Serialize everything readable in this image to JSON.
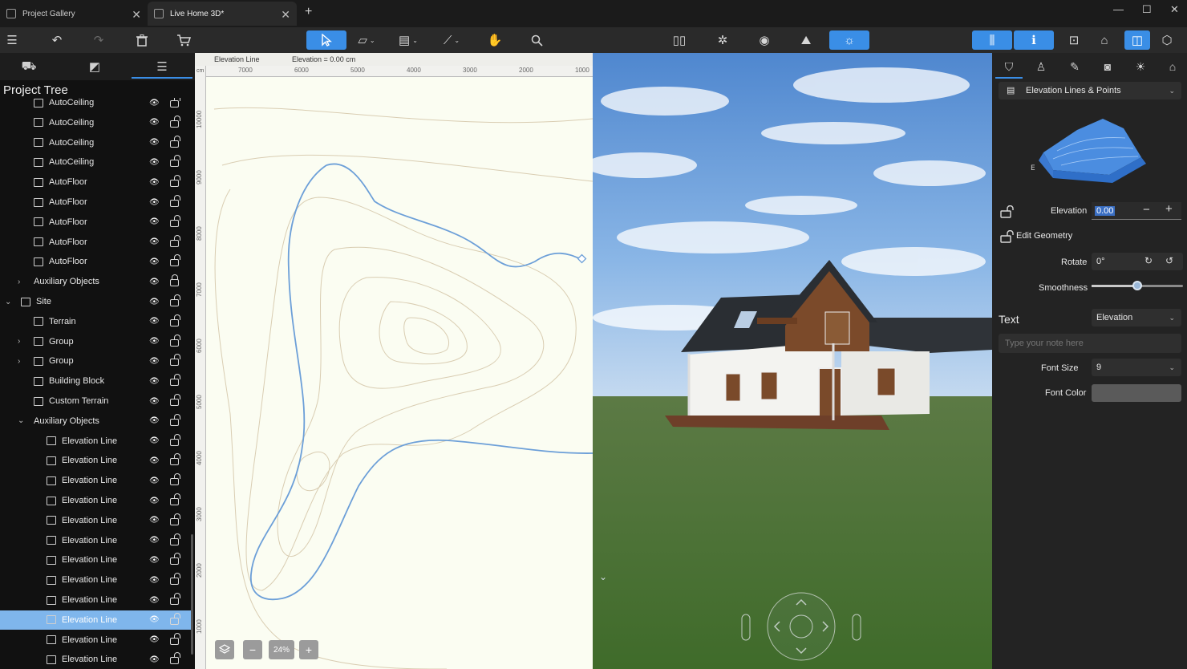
{
  "tabs": [
    {
      "label": "Project Gallery",
      "active": false
    },
    {
      "label": "Live Home 3D*",
      "active": true
    }
  ],
  "toolbar": {
    "left_icons": [
      "menu-icon",
      "undo-icon",
      "redo-icon",
      "trash-icon",
      "cart-icon"
    ],
    "center_icons": [
      "select-arrow-icon",
      "wall-tool-icon",
      "floor-tool-icon",
      "dimension-tool-icon",
      "pan-hand-icon",
      "search-icon"
    ],
    "view_icons": [
      "cameras-icon",
      "walkthrough-icon",
      "eye-icon",
      "roof-icon",
      "sun-icon"
    ],
    "right_icons": [
      "library-icon",
      "inspector-icon",
      "plan-view-icon",
      "3d-house-icon",
      "split-view-icon",
      "3d-box-icon"
    ]
  },
  "left_panel": {
    "tab_icons": [
      "furniture-icon",
      "materials-icon",
      "project-tree-icon"
    ],
    "title": "Project Tree",
    "rows": [
      {
        "label": "AutoCeiling",
        "indent": 2,
        "icon": "ceiling-icon",
        "chev": "",
        "locked": false,
        "selected": false
      },
      {
        "label": "AutoCeiling",
        "indent": 2,
        "icon": "ceiling-icon",
        "chev": "",
        "locked": false,
        "selected": false
      },
      {
        "label": "AutoCeiling",
        "indent": 2,
        "icon": "ceiling-icon",
        "chev": "",
        "locked": false,
        "selected": false
      },
      {
        "label": "AutoCeiling",
        "indent": 2,
        "icon": "ceiling-icon",
        "chev": "",
        "locked": false,
        "selected": false
      },
      {
        "label": "AutoFloor",
        "indent": 2,
        "icon": "floor-icon",
        "chev": "",
        "locked": false,
        "selected": false
      },
      {
        "label": "AutoFloor",
        "indent": 2,
        "icon": "floor-icon",
        "chev": "",
        "locked": false,
        "selected": false
      },
      {
        "label": "AutoFloor",
        "indent": 2,
        "icon": "floor-icon",
        "chev": "",
        "locked": false,
        "selected": false
      },
      {
        "label": "AutoFloor",
        "indent": 2,
        "icon": "floor-icon",
        "chev": "",
        "locked": false,
        "selected": false
      },
      {
        "label": "AutoFloor",
        "indent": 2,
        "icon": "floor-icon",
        "chev": "",
        "locked": false,
        "selected": false
      },
      {
        "label": "Auxiliary Objects",
        "indent": 1,
        "icon": "",
        "chev": "›",
        "locked": true,
        "selected": false
      },
      {
        "label": "Site",
        "indent": 0,
        "icon": "site-icon",
        "chev": "⌄",
        "locked": false,
        "selected": false
      },
      {
        "label": "Terrain",
        "indent": 2,
        "icon": "terrain-icon",
        "chev": "",
        "locked": false,
        "selected": false
      },
      {
        "label": "Group",
        "indent": 1,
        "icon": "folder-icon",
        "chev": "›",
        "locked": false,
        "selected": false
      },
      {
        "label": "Group",
        "indent": 1,
        "icon": "folder-icon",
        "chev": "›",
        "locked": false,
        "selected": false
      },
      {
        "label": "Building Block",
        "indent": 2,
        "icon": "building-block-icon",
        "chev": "",
        "locked": false,
        "selected": false
      },
      {
        "label": "Custom Terrain",
        "indent": 2,
        "icon": "custom-terrain-icon",
        "chev": "",
        "locked": false,
        "selected": false
      },
      {
        "label": "Auxiliary Objects",
        "indent": 1,
        "icon": "",
        "chev": "⌄",
        "locked": false,
        "selected": false
      },
      {
        "label": "Elevation Line",
        "indent": 3,
        "icon": "elevation-line-icon",
        "chev": "",
        "locked": false,
        "selected": false
      },
      {
        "label": "Elevation Line",
        "indent": 3,
        "icon": "elevation-line-icon",
        "chev": "",
        "locked": false,
        "selected": false
      },
      {
        "label": "Elevation Line",
        "indent": 3,
        "icon": "elevation-line-icon",
        "chev": "",
        "locked": false,
        "selected": false
      },
      {
        "label": "Elevation Line",
        "indent": 3,
        "icon": "elevation-line-icon",
        "chev": "",
        "locked": false,
        "selected": false
      },
      {
        "label": "Elevation Line",
        "indent": 3,
        "icon": "elevation-line-icon",
        "chev": "",
        "locked": false,
        "selected": false
      },
      {
        "label": "Elevation Line",
        "indent": 3,
        "icon": "elevation-line-icon",
        "chev": "",
        "locked": false,
        "selected": false
      },
      {
        "label": "Elevation Line",
        "indent": 3,
        "icon": "elevation-line-icon",
        "chev": "",
        "locked": false,
        "selected": false
      },
      {
        "label": "Elevation Line",
        "indent": 3,
        "icon": "elevation-line-icon",
        "chev": "",
        "locked": false,
        "selected": false
      },
      {
        "label": "Elevation Line",
        "indent": 3,
        "icon": "elevation-line-icon",
        "chev": "",
        "locked": false,
        "selected": false
      },
      {
        "label": "Elevation Line",
        "indent": 3,
        "icon": "elevation-line-icon",
        "chev": "",
        "locked": false,
        "selected": true
      },
      {
        "label": "Elevation Line",
        "indent": 3,
        "icon": "elevation-line-icon",
        "chev": "",
        "locked": false,
        "selected": false
      },
      {
        "label": "Elevation Line",
        "indent": 3,
        "icon": "elevation-line-icon",
        "chev": "",
        "locked": false,
        "selected": false
      }
    ]
  },
  "plan": {
    "header_name": "Elevation Line",
    "header_elevation": "Elevation = 0.00 cm",
    "unit": "cm",
    "ruler_top": [
      "7000",
      "6000",
      "5000",
      "4000",
      "3000",
      "2000",
      "1000"
    ],
    "ruler_left": [
      "10000",
      "9000",
      "8000",
      "7000",
      "6000",
      "5000",
      "4000",
      "3000",
      "2000",
      "1000"
    ],
    "zoom": "24%",
    "zoom_minus": "−",
    "zoom_plus": "+"
  },
  "inspector": {
    "tab_icons": [
      "object-icon",
      "stamp-icon",
      "paint-icon",
      "camera-icon",
      "light-icon",
      "building-icon"
    ],
    "type_label": "Elevation Lines & Points",
    "elevation_label": "Elevation",
    "elevation_value": "0.00",
    "edit_geometry_label": "Edit Geometry",
    "rotate_label": "Rotate",
    "rotate_value": "0°",
    "smoothness_label": "Smoothness",
    "smoothness_fraction": 0.5,
    "text_section": "Text",
    "text_select": "Elevation",
    "note_placeholder": "Type your note here",
    "font_size_label": "Font Size",
    "font_size_value": "9",
    "font_color_label": "Font Color",
    "font_color": "#5a5a5a",
    "preview_axis_label": "E"
  },
  "colors": {
    "accent": "#3a8ee6",
    "selected_row": "#7fb6ec",
    "elevation_line": "#6c9fd8",
    "contour": "#d9cdb2",
    "plan_bg": "#fbfdf2"
  }
}
